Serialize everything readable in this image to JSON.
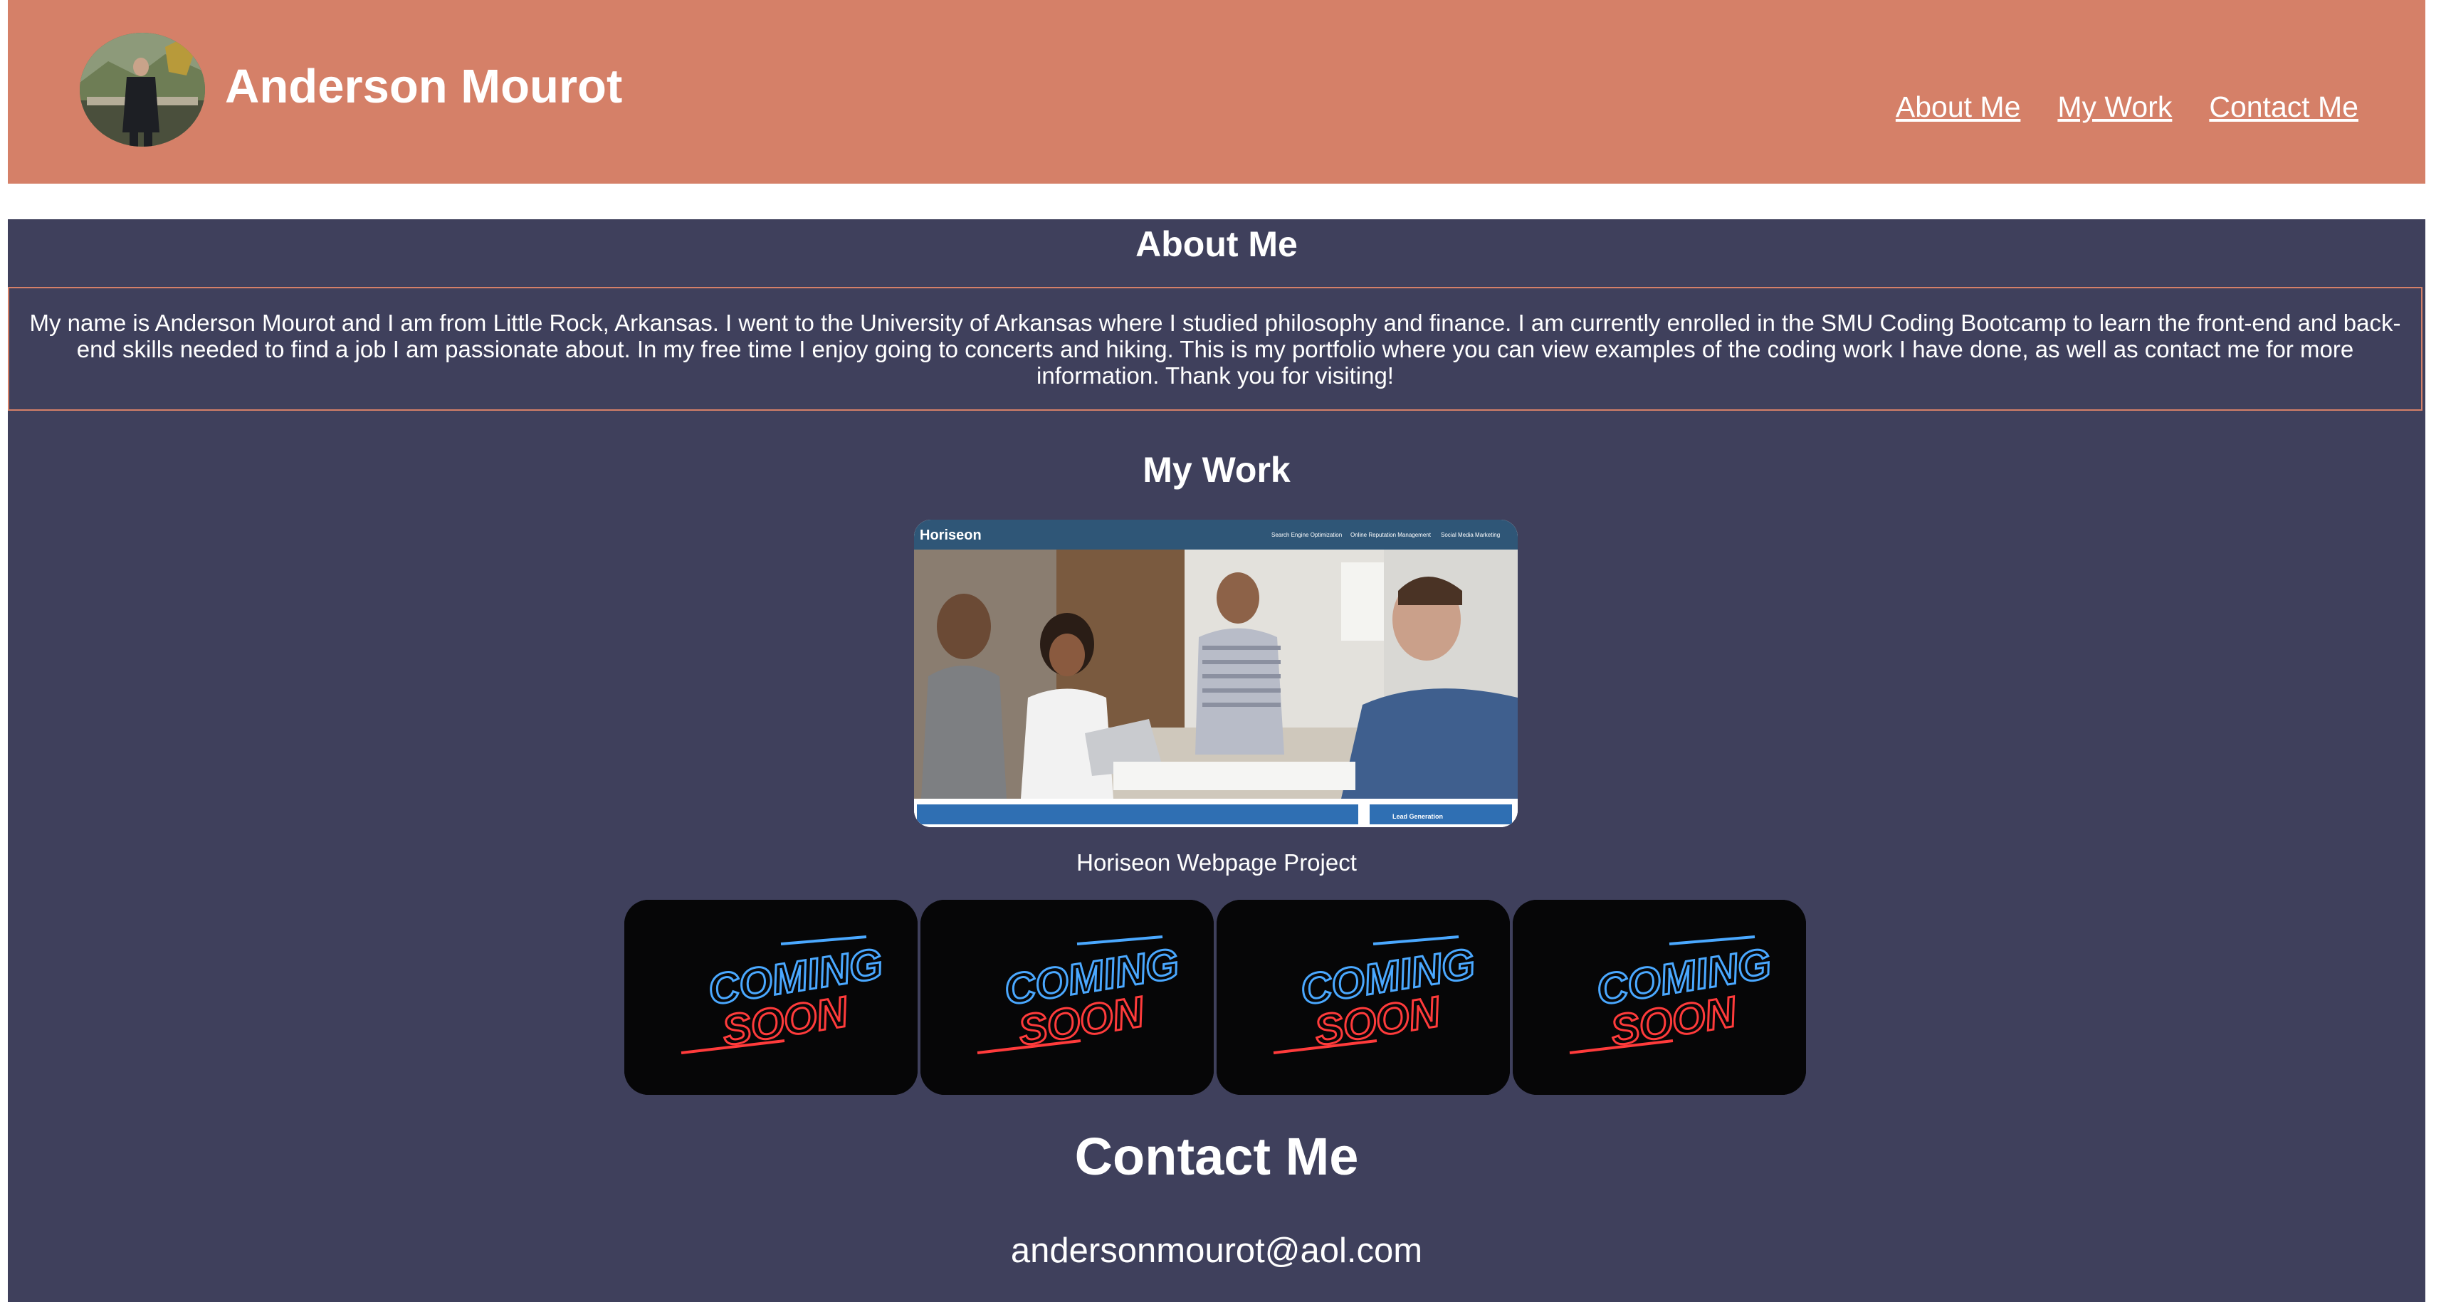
{
  "header": {
    "title": "Anderson Mourot",
    "nav": [
      "About Me",
      "My Work",
      "Contact Me"
    ]
  },
  "about": {
    "heading": "About Me",
    "text": "My name is Anderson Mourot and I am from Little Rock, Arkansas. I went to the University of Arkansas where I studied philosophy and finance. I am currently enrolled in the SMU Coding Bootcamp to learn the front-end and back-end skills needed to find a job I am passionate about. In my free time I enjoy going to concerts and hiking. This is my portfolio where you can view examples of the coding work I have done, as well as contact me for more information. Thank you for visiting!"
  },
  "work": {
    "heading": "My Work",
    "project": {
      "caption": "Horiseon Webpage Project",
      "screenshot_brand": "Horiseon",
      "screenshot_nav": [
        "Search Engine Optimization",
        "Online Reputation Management",
        "Social Media Marketing"
      ],
      "screenshot_sidebar": "Lead Generation"
    },
    "coming_soon": [
      {
        "line1": "COMING",
        "line2": "SOON"
      },
      {
        "line1": "COMING",
        "line2": "SOON"
      },
      {
        "line1": "COMING",
        "line2": "SOON"
      },
      {
        "line1": "COMING",
        "line2": "SOON"
      }
    ]
  },
  "contact": {
    "heading": "Contact Me",
    "email": "andersonmourot@aol.com"
  },
  "colors": {
    "header_bg": "#d58068",
    "main_bg": "#3f405c",
    "text": "#ffffff",
    "neon_blue": "#4aa8ff",
    "neon_red": "#ff3b3b"
  }
}
